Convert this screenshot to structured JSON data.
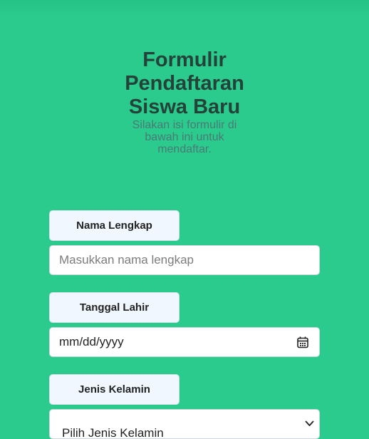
{
  "header": {
    "title": "Formulir Pendaftaran Siswa Baru",
    "subtitle": "Silakan isi formulir di bawah ini untuk mendaftar."
  },
  "form": {
    "name": {
      "label": "Nama Lengkap",
      "placeholder": "Masukkan nama lengkap"
    },
    "birthdate": {
      "label": "Tanggal Lahir",
      "placeholder": "mm/dd/yyyy",
      "icon": "calendar-icon"
    },
    "gender": {
      "label": "Jenis Kelamin",
      "selected": "Pilih Jenis Kelamin",
      "icon": "chevron-down-icon"
    }
  },
  "colors": {
    "background": "#2bcb8d",
    "title": "#24423a",
    "label_bg": "#f0f7ff"
  }
}
